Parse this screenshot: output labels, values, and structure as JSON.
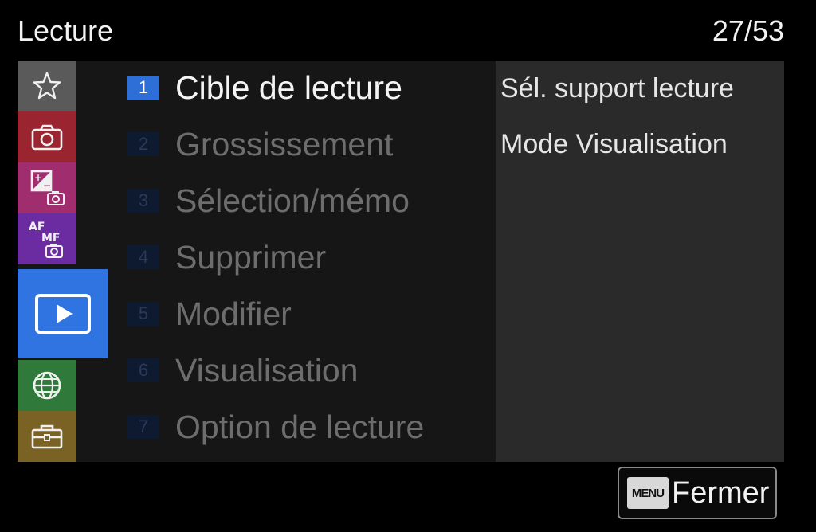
{
  "header": {
    "title": "Lecture",
    "page_indicator": "27/53"
  },
  "sidebar": {
    "tabs": [
      {
        "name": "favorites",
        "icon": "star-icon",
        "color": "#5a5a5a"
      },
      {
        "name": "shooting",
        "icon": "camera-icon",
        "color": "#9a2430"
      },
      {
        "name": "exposure-color",
        "icon": "exposure-camera-icon",
        "color": "#a02e6e"
      },
      {
        "name": "focus",
        "icon": "af-mf-camera-icon",
        "label_af": "AF",
        "label_mf": "MF",
        "color": "#6a2ca0"
      },
      {
        "name": "playback",
        "icon": "play-icon",
        "color": "#2f74e0",
        "active": true
      },
      {
        "name": "network",
        "icon": "globe-icon",
        "color": "#2f7a3a"
      },
      {
        "name": "setup",
        "icon": "toolbox-icon",
        "color": "#7a6224"
      }
    ]
  },
  "menu": {
    "items": [
      {
        "number": "1",
        "label": "Cible de lecture",
        "selected": true
      },
      {
        "number": "2",
        "label": "Grossissement",
        "selected": false
      },
      {
        "number": "3",
        "label": "Sélection/mémo",
        "selected": false
      },
      {
        "number": "4",
        "label": "Supprimer",
        "selected": false
      },
      {
        "number": "5",
        "label": "Modifier",
        "selected": false
      },
      {
        "number": "6",
        "label": "Visualisation",
        "selected": false
      },
      {
        "number": "7",
        "label": "Option de lecture",
        "selected": false
      }
    ]
  },
  "submenu": {
    "items": [
      {
        "label": "Sél. support lecture"
      },
      {
        "label": "Mode Visualisation"
      }
    ]
  },
  "footer": {
    "menu_key_label": "MENU",
    "close_label": "Fermer"
  },
  "colors": {
    "accent": "#2d6fd6",
    "background": "#000000",
    "panel": "#161616",
    "sub_panel": "#2a2a2a"
  }
}
